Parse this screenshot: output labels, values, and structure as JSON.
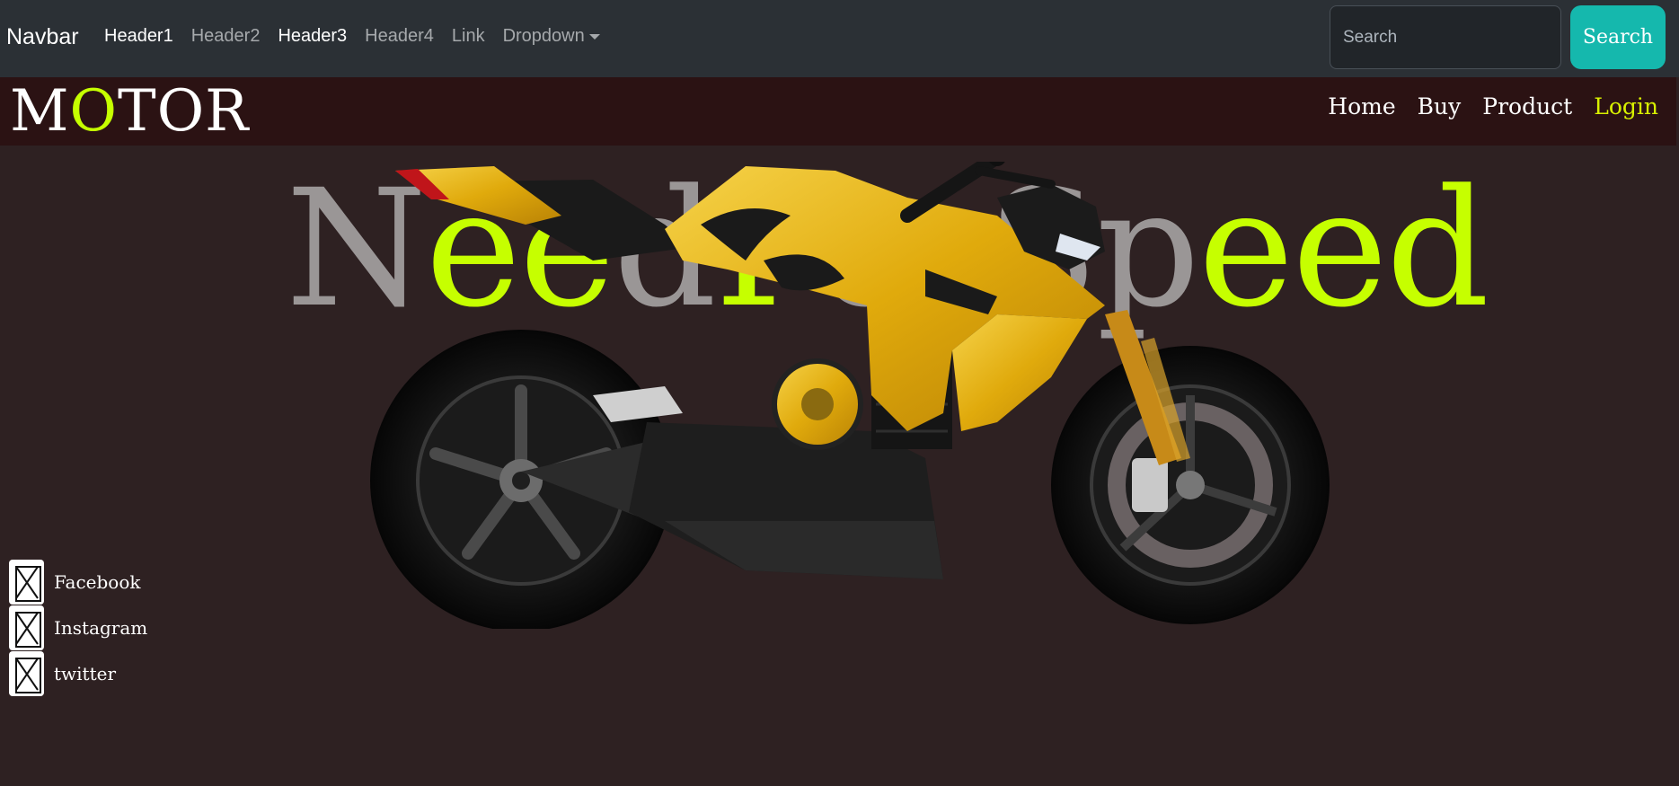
{
  "topnav": {
    "brand": "Navbar",
    "links": [
      {
        "label": "Header1"
      },
      {
        "label": "Header2"
      },
      {
        "label": "Header3"
      },
      {
        "label": "Header4"
      },
      {
        "label": "Link"
      },
      {
        "label": "Dropdown"
      }
    ],
    "search_placeholder": "Search",
    "search_button": "Search"
  },
  "site": {
    "logo_pre": "M",
    "logo_accent": "O",
    "logo_post": "TOR",
    "menu": [
      {
        "label": "Home"
      },
      {
        "label": "Buy"
      },
      {
        "label": "Product"
      },
      {
        "label": "Login"
      }
    ]
  },
  "hero": {
    "title_parts": [
      "N",
      "ee",
      "d",
      "F",
      "orSp",
      "eed"
    ],
    "image": "motorcycle-icon"
  },
  "social": [
    {
      "label": "Facebook",
      "icon": "broken-image-icon"
    },
    {
      "label": "Instagram",
      "icon": "broken-image-icon"
    },
    {
      "label": "twitter",
      "icon": "broken-image-icon"
    }
  ],
  "colors": {
    "accent": "#c6ff00",
    "search_button": "#15b8ad",
    "page_bg": "#2e2122",
    "header_bg": "#2b1213",
    "navbar_bg": "#2b3035",
    "bike_yellow": "#e8b70e"
  }
}
